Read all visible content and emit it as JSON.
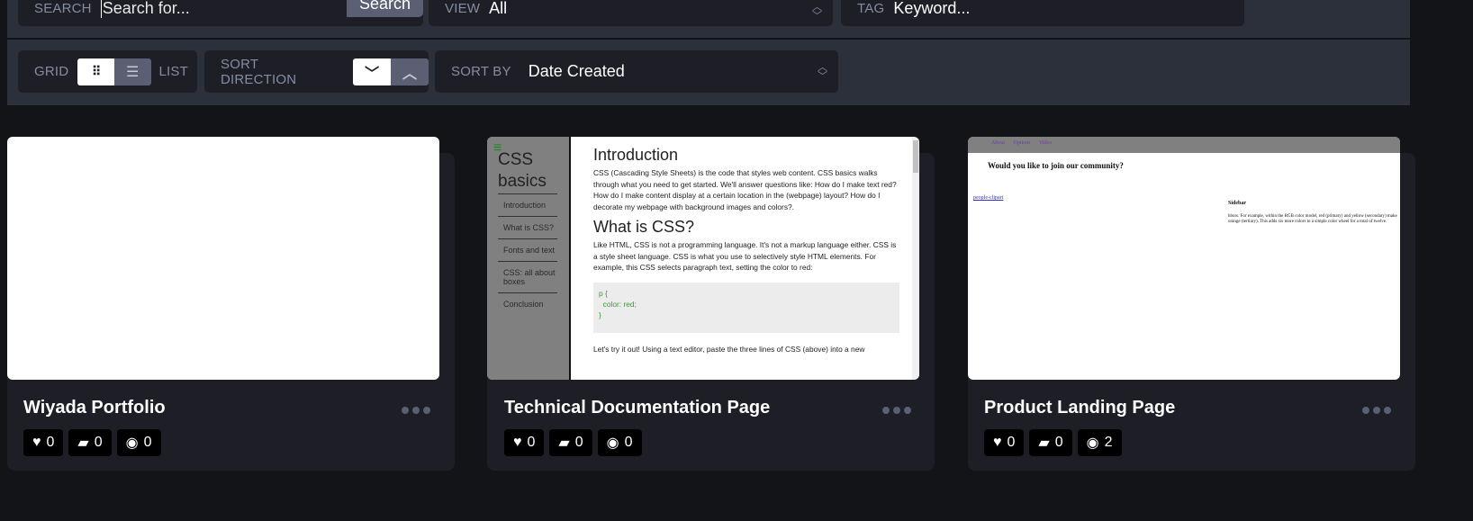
{
  "filters": {
    "search_label": "Search",
    "search_placeholder": "Search for...",
    "search_button": "Search",
    "view_label": "View",
    "view_value": "All",
    "tag_label": "Tag",
    "tag_placeholder": "Keyword..."
  },
  "controls": {
    "grid_label": "Grid",
    "list_label": "List",
    "layout_selected": "grid",
    "sort_direction_label": "Sort Direction",
    "sort_direction_selected": "descending",
    "sort_by_label": "Sort By",
    "sort_by_value": "Date Created"
  },
  "cards": [
    {
      "title": "Wiyada Portfolio",
      "likes": "0",
      "comments": "0",
      "views": "0"
    },
    {
      "title": "Technical Documentation Page",
      "likes": "0",
      "comments": "0",
      "views": "0",
      "preview": {
        "sidebar_title": "CSS basics",
        "nav": [
          "Introduction",
          "What is CSS?",
          "Fonts and text",
          "CSS: all about boxes",
          "Conclusion"
        ],
        "h1": "Introduction",
        "p1": "CSS (Cascading Style Sheets) is the code that styles web content. CSS basics walks through what you need to get started. We'll answer questions like: How do I make text red? How do I make content display at a certain location in the (webpage) layout? How do I decorate my webpage with background images and colors?.",
        "h2": "What is CSS?",
        "p2": "Like HTML, CSS is not a programming language. It's not a markup language either. CSS is a style sheet language. CSS is what you use to selectively style HTML elements. For example, this CSS selects paragraph text, setting the color to red:",
        "code": [
          "p {",
          "  color: red;",
          "}"
        ],
        "p3": "Let's try it out! Using a text editor, paste the three lines of CSS (above) into a new"
      }
    },
    {
      "title": "Product Landing Page",
      "likes": "0",
      "comments": "0",
      "views": "2",
      "preview": {
        "nav": "About Options Video",
        "heading": "Would you like to join our community?",
        "img_alt": "people-clipart",
        "sidebar_title": "Sidebar",
        "sidebar_text": "hbors. For example, within the RGB color model, red (primary) and yellow (secondary) make orange (tertiary). This adds six more colors to a simple color wheel for a total of twelve."
      }
    }
  ]
}
